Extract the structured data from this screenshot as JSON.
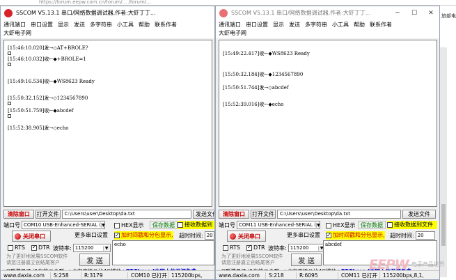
{
  "browser": {
    "url_fragment": "https://forum.eepw.com.cn/forum/... /forum/..."
  },
  "left": {
    "title": "SSCOM V5.13.1 串口/网络数据调试器,作者:大虾丁丁...",
    "menu": [
      "通讯端口",
      "串口设置",
      "显示",
      "发送",
      "多字符串",
      "小工具",
      "帮助",
      "联系作者"
    ],
    "menu2": "大虾电子网",
    "log": [
      "[15:46:10.020]发→◇AT+BROLE?",
      "[15:46:10.032]收←◆+BROLE=1",
      "[15:49:16.534]收←◆WS8623 Ready",
      "[15:50:32.152]发→◇1234567890",
      "[15:50:51.759]收←◆abcdef",
      "[15:52:38.905]发→◇echo"
    ],
    "clear_btn": "清除窗口",
    "open_file_btn": "打开文件",
    "file_path": "C:\\Users\\user\\Desktop\\da.txt",
    "send_file_btn": "发送文件",
    "port_label": "端口号",
    "port_value": "COM10 USB-Enhanced-SERIAL (",
    "hex_display": "HEX显示",
    "save_data": "保存数据",
    "recv_to_file": "接收数据到",
    "close_port_btn": "关闭串口",
    "more_settings": "更多串口设置",
    "timestamp": "加时间戳和分包显示,",
    "timeout_label": "超时时间:",
    "timeout_value": "20",
    "rts": "RTS",
    "dtr": "DTR",
    "baud_label": "波特率:",
    "baud_value": "115200",
    "send_text": "echo",
    "send_btn": "发 送",
    "promo": [
      "为了更好地发展SSCOM软件",
      "请您注册嘉立创结尾客户"
    ],
    "ticker_a": "▲Q群满员了,没有第二个群. ★合宙高性价比4G模块 ",
    "ticker_b": "★RT-Thread中国人的开源免费",
    "status": [
      "www.daxia.com",
      "S:258",
      "R:3179",
      "COM10 已打开",
      "115200bps,"
    ]
  },
  "right": {
    "title": "SSCOM V5.13.1 串口/网络数据调试器,作者:大虾丁丁...",
    "menu": [
      "通讯端口",
      "串口设置",
      "显示",
      "发送",
      "多字符串",
      "小工具",
      "帮助",
      "联系作者"
    ],
    "menu2": "大虾电子网",
    "log": [
      "[15:49:22.417]收←◆WS8623 Ready",
      "[15:50:32.184]收←◆1234567890",
      "[15:50:51.744]发→◇abcdef",
      "[15:52:39.016]收←◆echo"
    ],
    "clear_btn": "清除窗口",
    "open_file_btn": "打开文件",
    "file_path": "C:\\Users\\user\\Desktop\\da.txt",
    "send_file_btn": "发送文件",
    "port_label": "端口号",
    "port_value": "COM11 USB-Enhanced-SERIAL (",
    "hex_display": "HEX显示",
    "save_data": "保存数据",
    "recv_to_file": "接收数据到文件",
    "close_port_btn": "关闭串口",
    "more_settings": "更多串口设置",
    "timestamp": "加时间戳和分包显示,",
    "timeout_label": "超时时间:",
    "timeout_value": "20",
    "rts": "RTS",
    "dtr": "DTR",
    "baud_label": "波特率:",
    "baud_value": "115200",
    "send_text": "abcdef",
    "send_btn": "发 送",
    "promo": [
      "为了更好地发展SSCOM软件",
      "请您注册嘉立创结尾客户"
    ],
    "ticker_a": "▲Q群满员了,没有第二个群. ★合宙高性价比4G模块 ",
    "ticker_b": "★RT-Thread中国人的开源免费",
    "status": [
      "www.daxia.com",
      "S:218",
      "R:6095",
      "COM11 已打开",
      "115200bps,8,1,"
    ]
  },
  "background": {
    "edge_text": "旅部电"
  },
  "watermark": {
    "logo": "EEPW",
    "sub": "电子产品世界"
  }
}
